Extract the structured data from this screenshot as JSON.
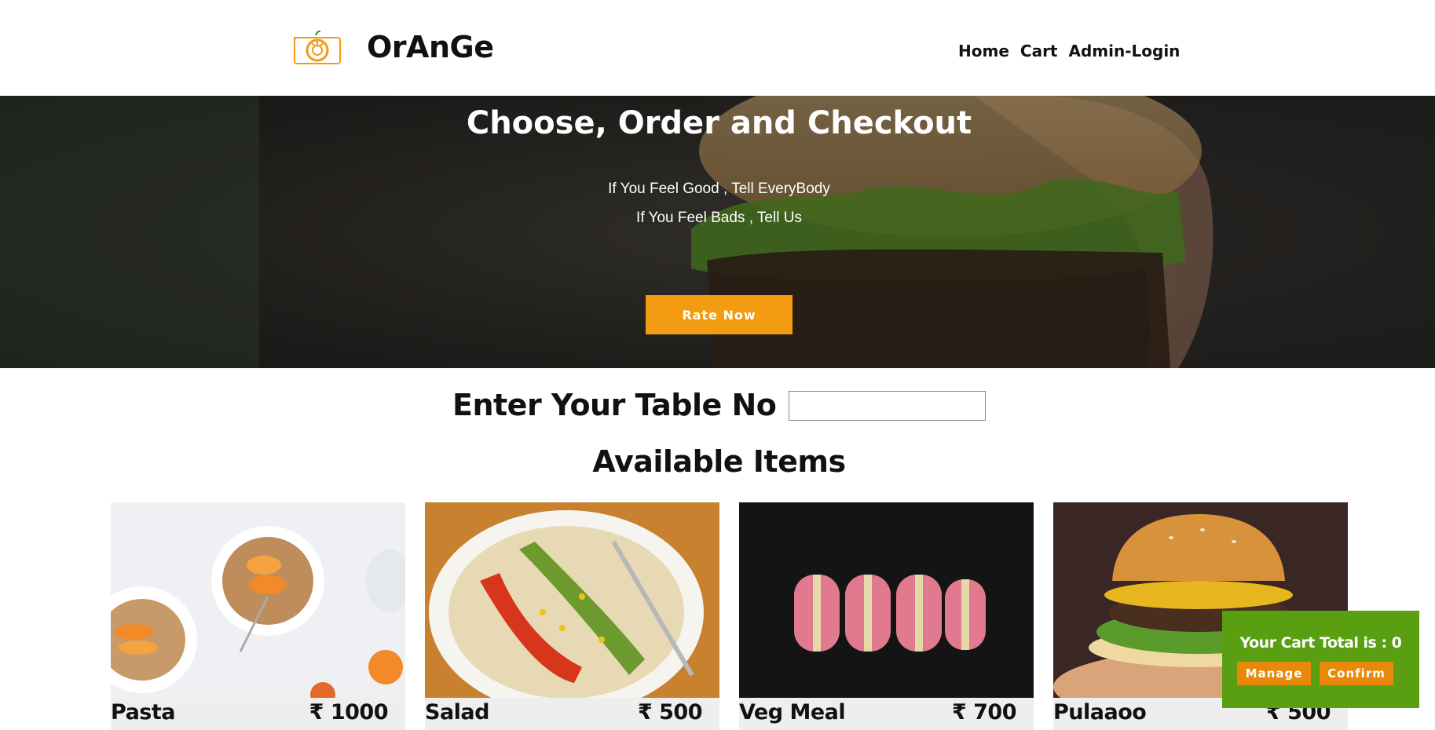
{
  "brand": {
    "name": "OrAnGe",
    "logo": "camera-orange-logo-icon"
  },
  "nav": {
    "home": "Home",
    "cart": "Cart",
    "admin": "Admin-Login"
  },
  "hero": {
    "title": "Choose, Order and Checkout",
    "line1": "If You Feel Good , Tell EveryBody",
    "line2": "If You Feel Bads , Tell Us",
    "button": "Rate Now"
  },
  "table": {
    "label": "Enter Your Table No :",
    "value": ""
  },
  "items": {
    "heading": "Available Items",
    "list": [
      {
        "name": "Pasta",
        "price": "₹ 1000"
      },
      {
        "name": "Salad",
        "price": "₹ 500"
      },
      {
        "name": "Veg Meal",
        "price": "₹ 700"
      },
      {
        "name": "Pulaaoo",
        "price": "₹ 500"
      }
    ]
  },
  "cart": {
    "total_label": "Your Cart Total is : 0",
    "manage": "Manage",
    "confirm": "Confirm"
  },
  "colors": {
    "accent": "#f39c12",
    "cart_bg": "#5a9e12",
    "cart_button": "#e8890c"
  }
}
